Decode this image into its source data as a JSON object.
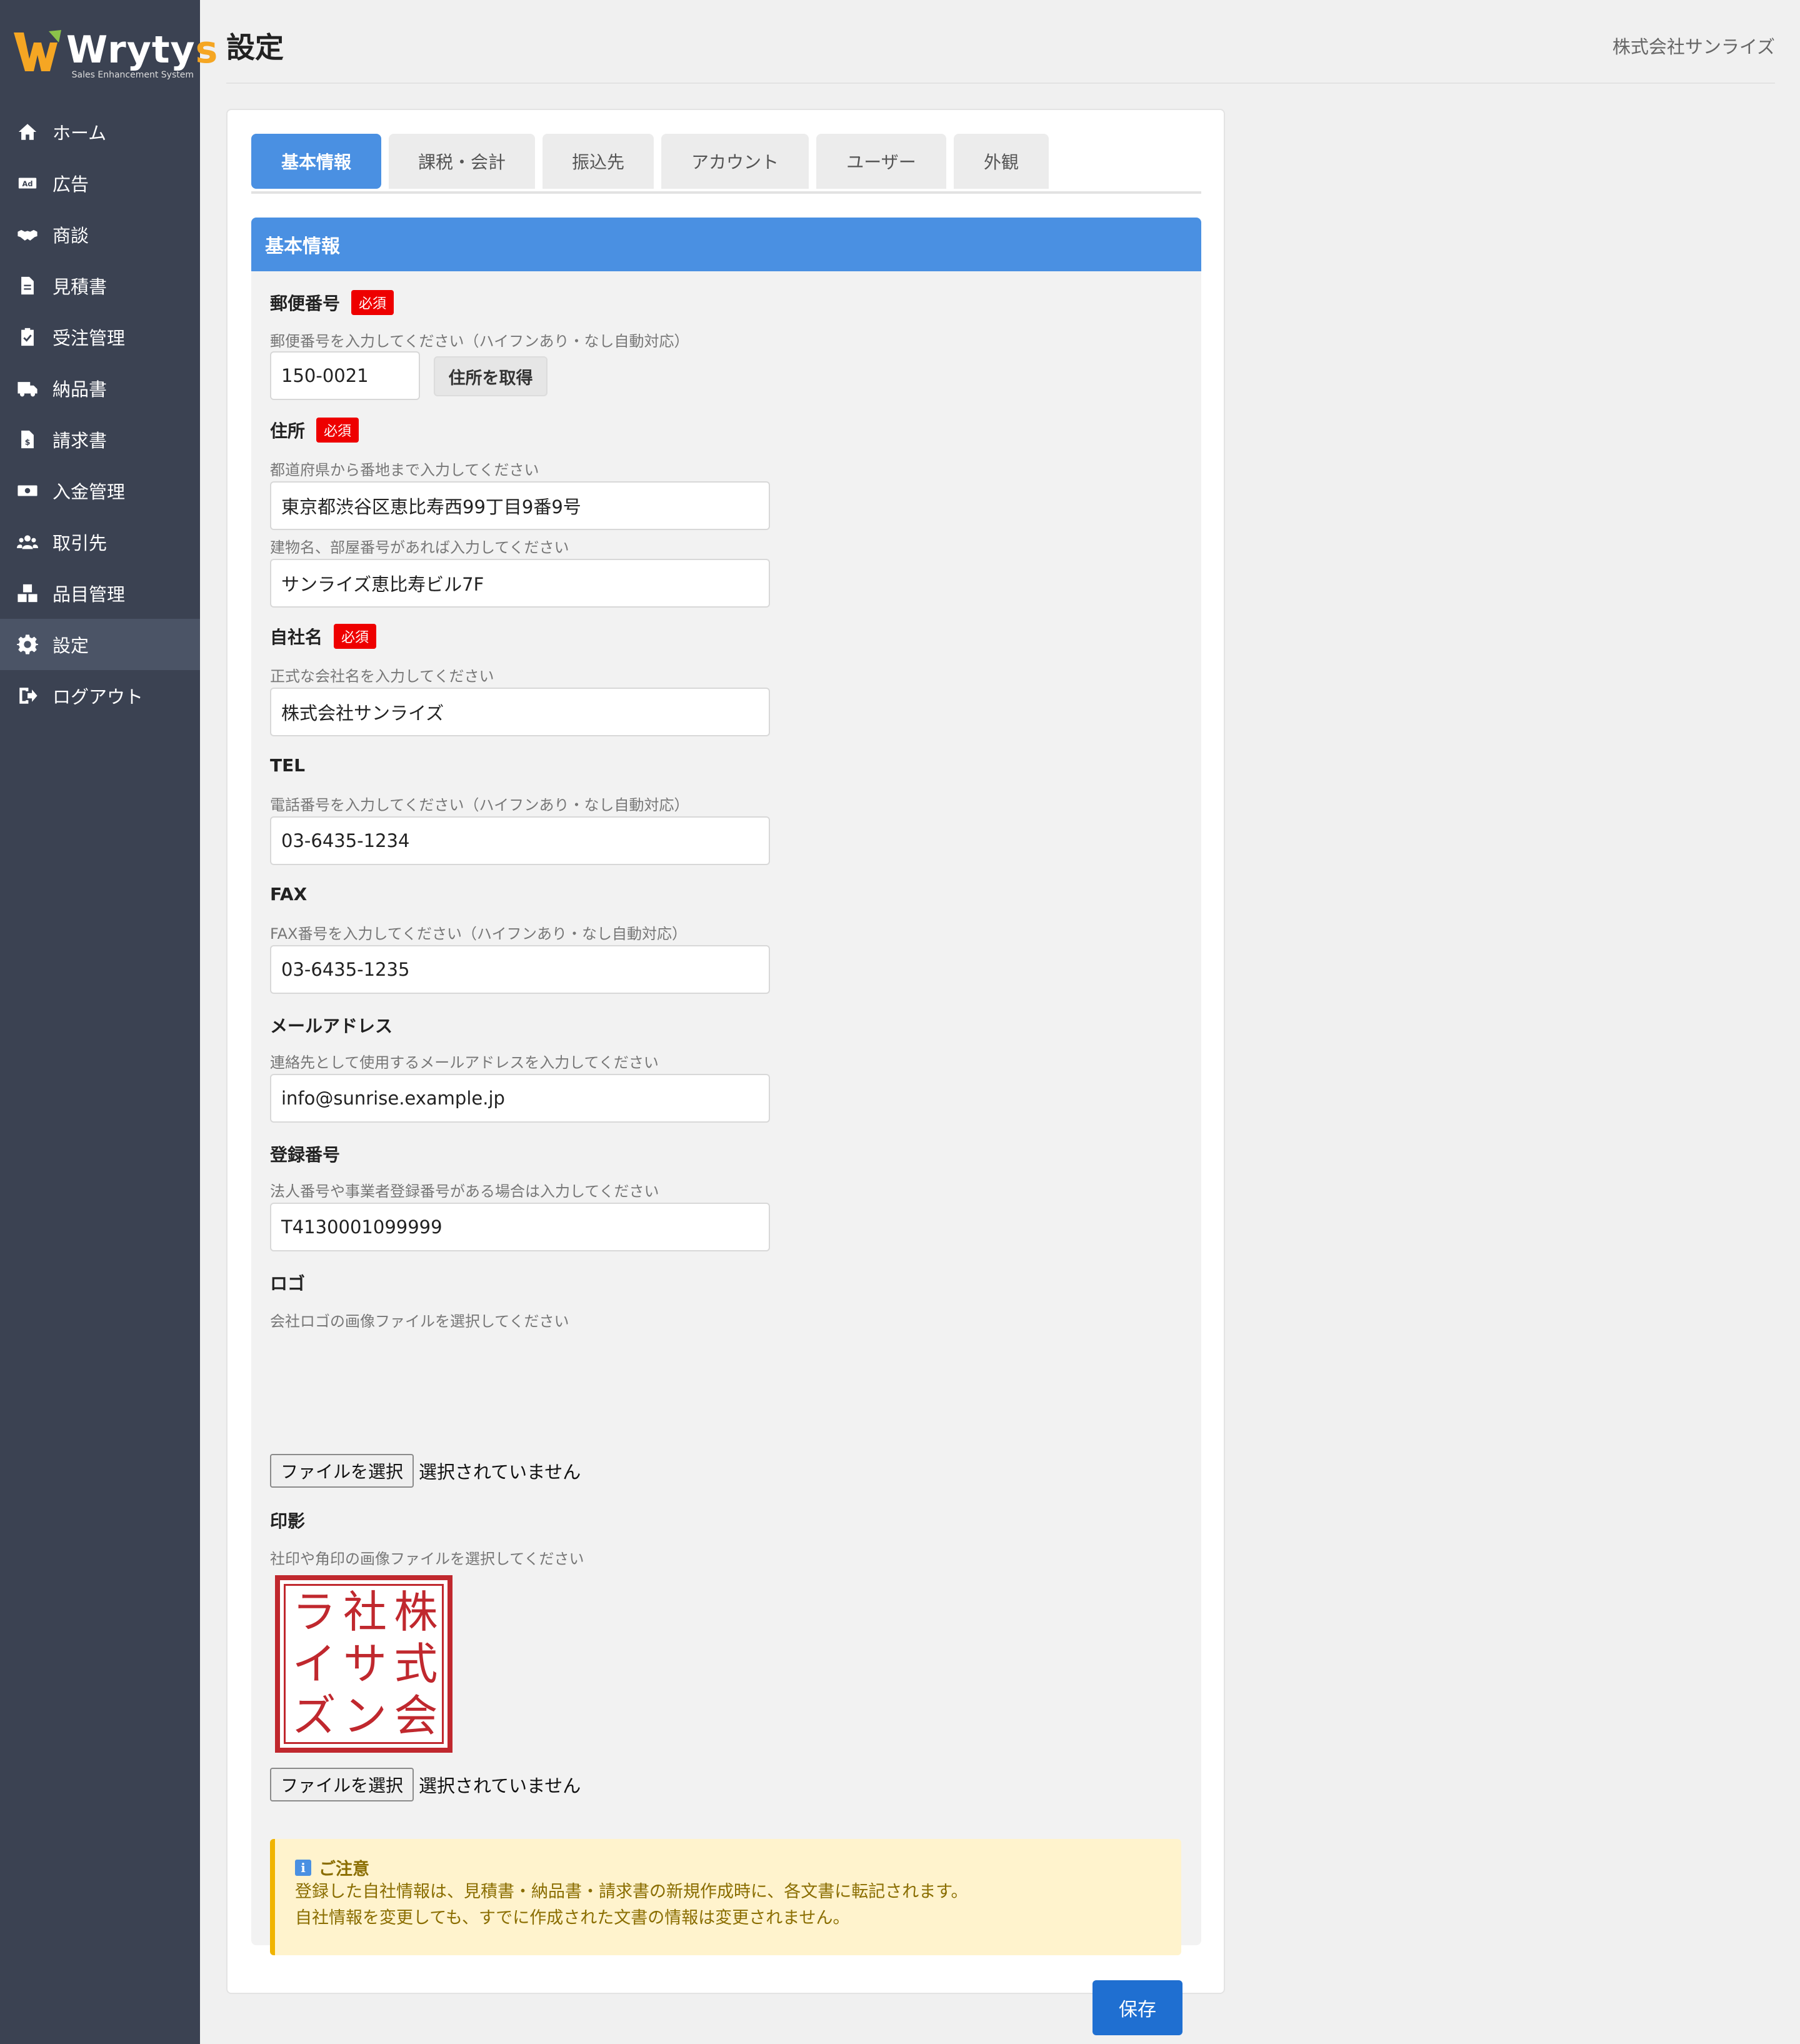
{
  "app": {
    "logo_text_main": "Wryty",
    "logo_text_accent": "s",
    "logo_sub": "Sales Enhancement System"
  },
  "header": {
    "title": "設定",
    "company": "株式会社サンライズ"
  },
  "sidebar": {
    "items": [
      {
        "label": "ホーム",
        "icon": "home-icon"
      },
      {
        "label": "広告",
        "icon": "ad-icon"
      },
      {
        "label": "商談",
        "icon": "handshake-icon"
      },
      {
        "label": "見積書",
        "icon": "document-icon"
      },
      {
        "label": "受注管理",
        "icon": "clipboard-check-icon"
      },
      {
        "label": "納品書",
        "icon": "truck-icon"
      },
      {
        "label": "請求書",
        "icon": "invoice-icon"
      },
      {
        "label": "入金管理",
        "icon": "money-icon"
      },
      {
        "label": "取引先",
        "icon": "users-icon"
      },
      {
        "label": "品目管理",
        "icon": "boxes-icon"
      },
      {
        "label": "設定",
        "icon": "gear-icon",
        "active": true
      },
      {
        "label": "ログアウト",
        "icon": "logout-icon"
      }
    ]
  },
  "tabs": [
    "基本情報",
    "課税・会計",
    "振込先",
    "アカウント",
    "ユーザー",
    "外観"
  ],
  "section": {
    "title": "基本情報"
  },
  "form": {
    "required_label": "必須",
    "postal": {
      "label": "郵便番号",
      "help": "郵便番号を入力してください（ハイフンあり・なし自動対応）",
      "value": "150-0021",
      "lookup_button": "住所を取得"
    },
    "address": {
      "label": "住所",
      "help": "都道府県から番地まで入力してください",
      "value": "東京都渋谷区恵比寿西99丁目9番9号",
      "help2": "建物名、部屋番号があれば入力してください",
      "value2": "サンライズ恵比寿ビル7F"
    },
    "company": {
      "label": "自社名",
      "help": "正式な会社名を入力してください",
      "value": "株式会社サンライズ"
    },
    "tel": {
      "label": "TEL",
      "help": "電話番号を入力してください（ハイフンあり・なし自動対応）",
      "value": "03-6435-1234"
    },
    "fax": {
      "label": "FAX",
      "help": "FAX番号を入力してください（ハイフンあり・なし自動対応）",
      "value": "03-6435-1235"
    },
    "email": {
      "label": "メールアドレス",
      "help": "連絡先として使用するメールアドレスを入力してください",
      "value": "info@sunrise.example.jp"
    },
    "registration": {
      "label": "登録番号",
      "help": "法人番号や事業者登録番号がある場合は入力してください",
      "value": "T4130001099999"
    },
    "logo": {
      "label": "ロゴ",
      "help": "会社ロゴの画像ファイルを選択してください",
      "file_button": "ファイルを選択",
      "file_status": "選択されていません"
    },
    "seal": {
      "label": "印影",
      "help": "社印や角印の画像ファイルを選択してください",
      "stamp_chars": [
        "ラ",
        "社",
        "株",
        "イ",
        "サ",
        "式",
        "ズ",
        "ン",
        "会"
      ],
      "file_button": "ファイルを選択",
      "file_status": "選択されていません"
    }
  },
  "notice": {
    "title": "ご注意",
    "line1": "登録した自社情報は、見積書・納品書・請求書の新規作成時に、各文書に転記されます。",
    "line2": "自社情報を変更しても、すでに作成された文書の情報は変更されません。"
  },
  "save_button": "保存",
  "colors": {
    "sidebar_bg": "#3b4252",
    "accent": "#4a90e2",
    "save": "#1f6fd1",
    "required": "#e00000",
    "stamp": "#c0282e",
    "notice_bg": "#fff3cd"
  }
}
